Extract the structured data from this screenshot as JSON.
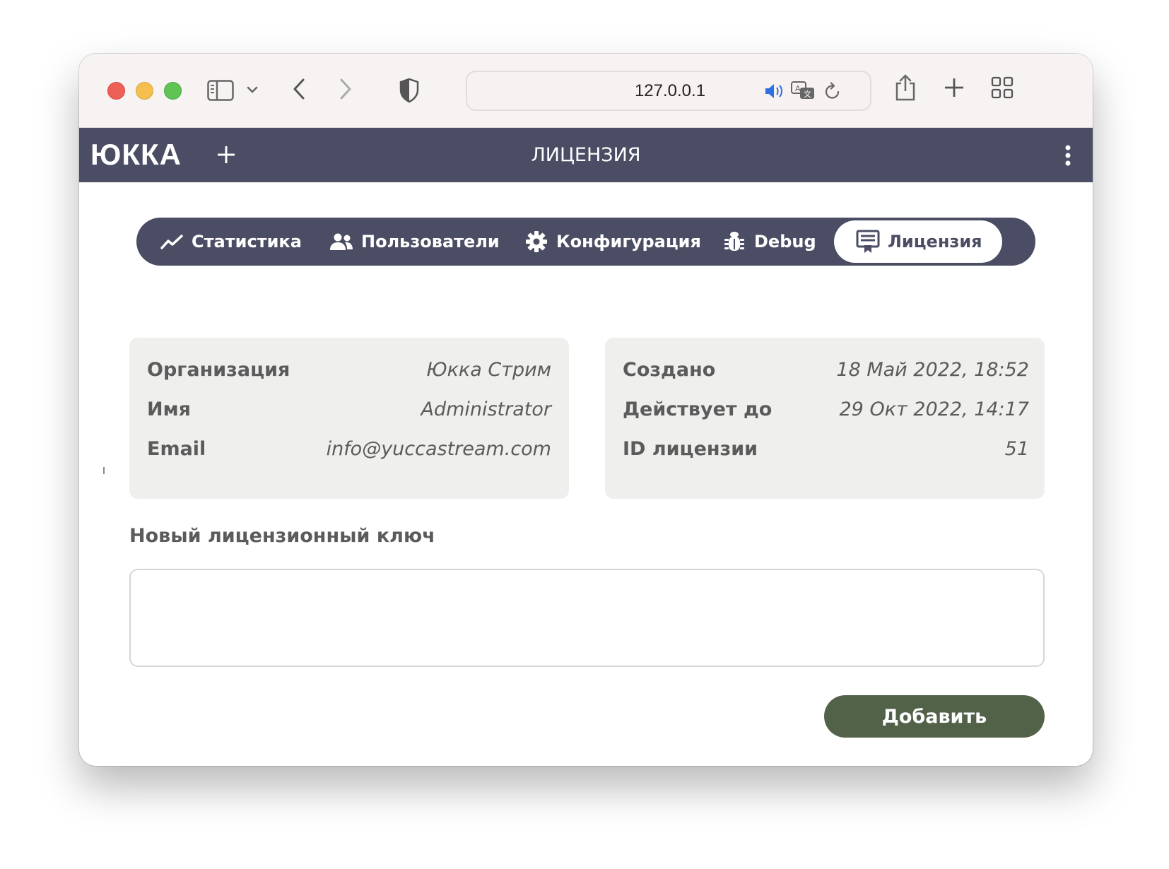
{
  "browser": {
    "url": "127.0.0.1",
    "icons": [
      "sidebar-icon",
      "chevron-down-icon",
      "back-arrow-icon",
      "forward-arrow-icon",
      "shield-icon",
      "speaker-icon",
      "translate-icon",
      "reload-icon",
      "share-icon",
      "plus-icon",
      "tab-overview-icon"
    ]
  },
  "app": {
    "logo": "ЮККА",
    "page_title": "ЛИЦЕНЗИЯ",
    "header_color": "#4a4d63"
  },
  "tabs": [
    {
      "label": "Статистика",
      "icon": "chart-line-icon",
      "active": false
    },
    {
      "label": "Пользователи",
      "icon": "users-icon",
      "active": false
    },
    {
      "label": "Конфигурация",
      "icon": "gear-icon",
      "active": false
    },
    {
      "label": "Debug",
      "icon": "bug-icon",
      "active": false
    },
    {
      "label": "Лицензия",
      "icon": "certificate-icon",
      "active": true
    }
  ],
  "license_owner": [
    {
      "label": "Организация",
      "value": "Юкка Стрим"
    },
    {
      "label": "Имя",
      "value": "Administrator"
    },
    {
      "label": "Email",
      "value": "info@yuccastream.com"
    }
  ],
  "license_info": [
    {
      "label": "Создано",
      "value": "18 Май 2022, 18:52"
    },
    {
      "label": "Действует до",
      "value": "29 Окт 2022, 14:17"
    },
    {
      "label": "ID лицензии",
      "value": "51"
    }
  ],
  "new_key": {
    "label": "Новый лицензионный ключ",
    "value": "",
    "placeholder": ""
  },
  "add_button": {
    "label": "Добавить",
    "color": "#526249"
  }
}
